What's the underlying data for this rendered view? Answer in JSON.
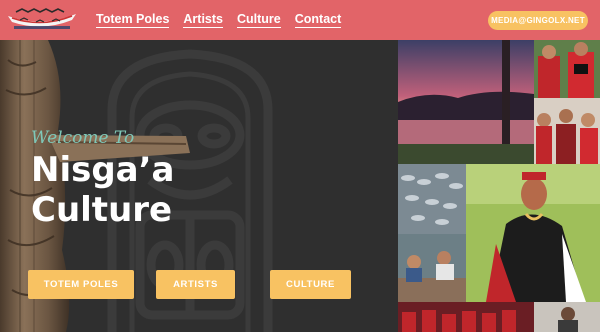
{
  "nav": {
    "items": [
      "Totem Poles",
      "Artists",
      "Culture",
      "Contact"
    ],
    "email_button": "MEDIA@GINGOLX.NET"
  },
  "hero": {
    "welcome": "Welcome To",
    "title_line1": "Nisga’a",
    "title_line2": "Culture",
    "buttons": [
      "TOTEM POLES",
      "ARTISTS",
      "CULTURE"
    ]
  },
  "colors": {
    "header_bg": "#e26468",
    "accent_button": "#f8c262",
    "welcome_text": "#7fc8b8",
    "hero_bg": "#2f2f2f"
  },
  "icons": [
    "logo-canoe-icon"
  ]
}
